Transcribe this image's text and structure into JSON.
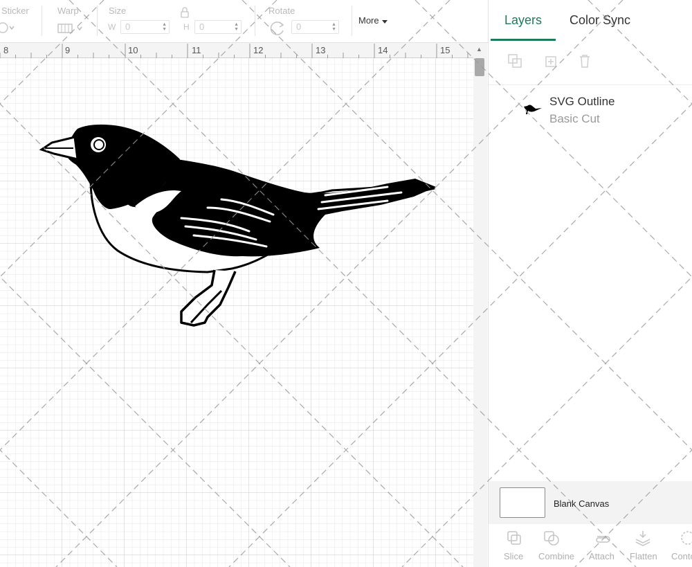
{
  "toolbar": {
    "sticker_label": "Sticker",
    "warp_label": "Warp",
    "size_label": "Size",
    "rotate_label": "Rotate",
    "w_label": "W",
    "h_label": "H",
    "w_value": "0",
    "h_value": "0",
    "rotate_value": "0",
    "more_label": "More"
  },
  "ruler": {
    "numbers": [
      "8",
      "9",
      "10",
      "11",
      "12",
      "13",
      "14",
      "15"
    ]
  },
  "panel": {
    "tabs": [
      {
        "label": "Layers",
        "active": true
      },
      {
        "label": "Color Sync",
        "active": false
      }
    ],
    "layer": {
      "name": "SVG Outline",
      "operation": "Basic Cut",
      "icon": "bird-thumbnail-icon"
    },
    "blank_canvas_label": "Blank Canvas",
    "actions": [
      {
        "label": "Slice",
        "icon": "slice-icon"
      },
      {
        "label": "Combine",
        "icon": "combine-icon"
      },
      {
        "label": "Attach",
        "icon": "attach-icon"
      },
      {
        "label": "Flatten",
        "icon": "flatten-icon"
      },
      {
        "label": "Conto",
        "icon": "contour-icon"
      }
    ]
  },
  "colors": {
    "accent": "#1a7d57",
    "grid_minor": "#e6e6e6",
    "grid_major": "#c8c8c8"
  }
}
